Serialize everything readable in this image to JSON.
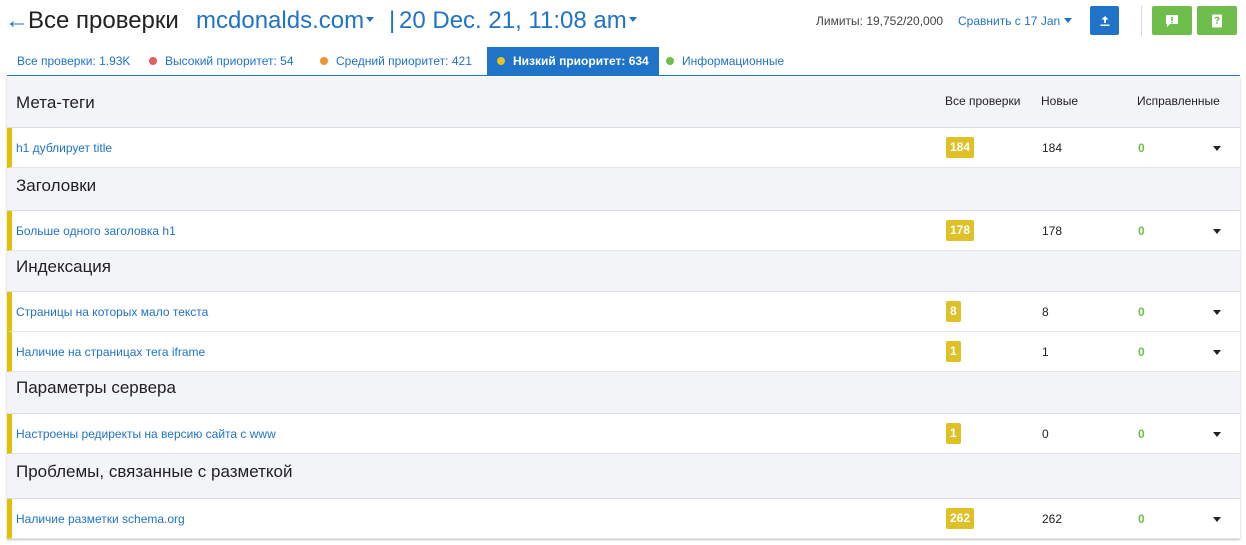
{
  "header": {
    "back_glyph": "←",
    "title": "Все проверки",
    "domain": "mcdonalds.com",
    "separator": "|",
    "date": "20 Dec. 21, 11:08 am",
    "limits": "Лимиты: 19,752/20,000",
    "compare": "Сравнить с  17 Jan",
    "icons": {
      "export": "upload-icon",
      "feedback": "exclamation-icon",
      "help": "question-icon"
    }
  },
  "tabs": [
    {
      "label": "Все проверки: 1.93K",
      "color": ""
    },
    {
      "label": "Высокий приоритет: 54",
      "color": "#e05d63"
    },
    {
      "label": "Средний приоритет: 421",
      "color": "#f0942d"
    },
    {
      "label": "Низкий приоритет: 634",
      "color": "#e6c41c",
      "active": true
    },
    {
      "label": "Информационные",
      "color": "#6fbd4a"
    }
  ],
  "columns": {
    "all": "Все проверки",
    "new": "Новые",
    "fixed": "Исправленные"
  },
  "groups": [
    {
      "title": "Мета-теги",
      "rows": [
        {
          "name": "h1 дублирует title",
          "all": "184",
          "new": "184",
          "fixed": "0"
        }
      ]
    },
    {
      "title": "Заголовки",
      "rows": [
        {
          "name": "Больше одного заголовка h1",
          "all": "178",
          "new": "178",
          "fixed": "0"
        }
      ]
    },
    {
      "title": "Индексация",
      "rows": [
        {
          "name": "Страницы на которых мало текста",
          "all": "8",
          "new": "8",
          "fixed": "0"
        },
        {
          "name": "Наличие на страницах тега iframe",
          "all": "1",
          "new": "1",
          "fixed": "0"
        }
      ]
    },
    {
      "title": "Параметры сервера",
      "rows": [
        {
          "name": "Настроены редиректы на версию сайта с www",
          "all": "1",
          "new": "0",
          "fixed": "0"
        }
      ]
    },
    {
      "title": "Проблемы, связанные с разметкой",
      "rows": [
        {
          "name": "Наличие разметки schema.org",
          "all": "262",
          "new": "262",
          "fixed": "0"
        }
      ]
    }
  ],
  "colors": {
    "accent": "#1f73c8",
    "low_priority": "#e0c200",
    "green": "#6fbd4a"
  }
}
